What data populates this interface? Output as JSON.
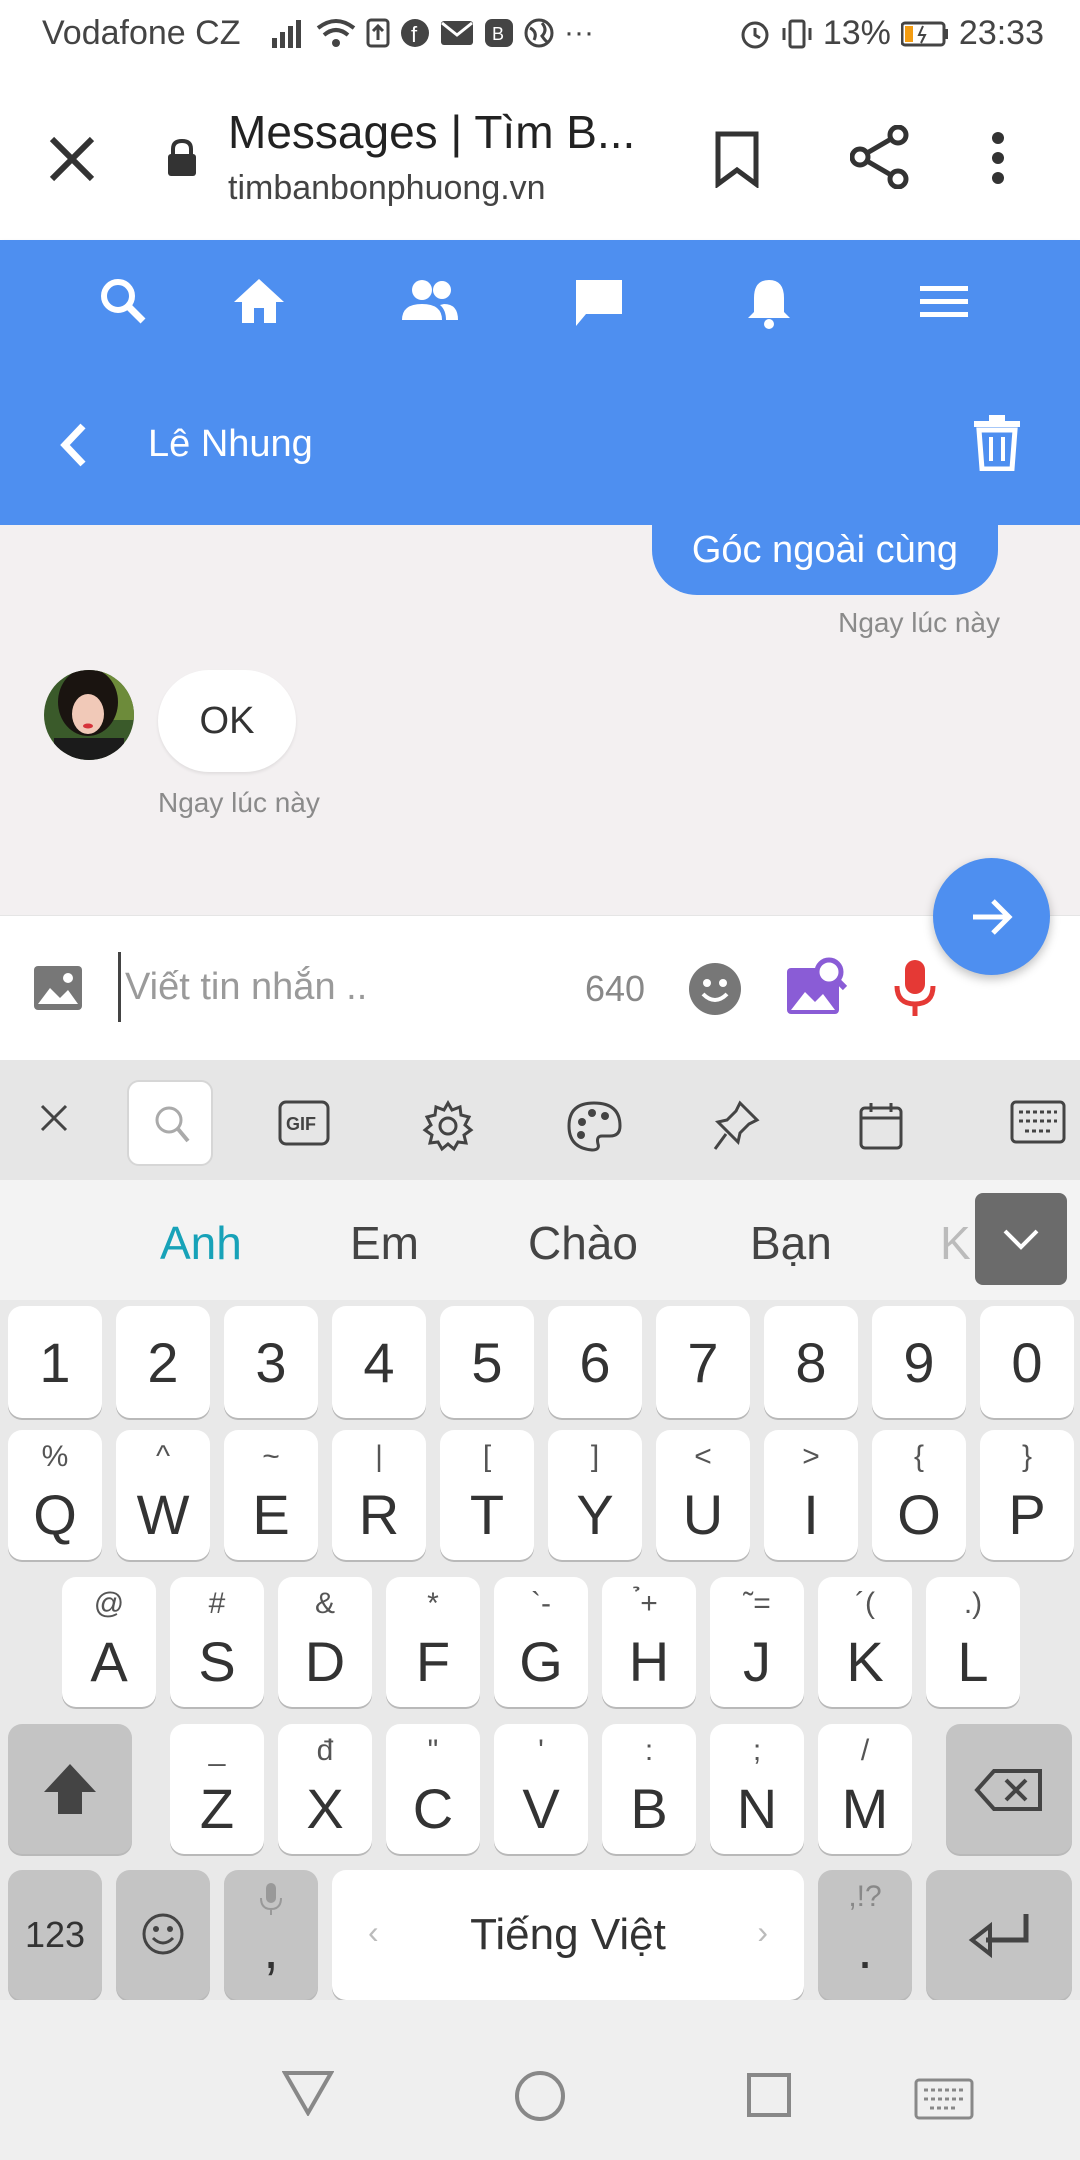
{
  "status_bar": {
    "carrier": "Vodafone CZ",
    "battery": "13%",
    "time": "23:33"
  },
  "browser": {
    "page_title": "Messages | Tìm B...",
    "url": "timbanbonphuong.vn"
  },
  "site_nav": {
    "icons": [
      "search-icon",
      "home-icon",
      "friends-icon",
      "messages-icon",
      "notifications-icon",
      "menu-icon"
    ]
  },
  "chat": {
    "contact_name": "Lê Nhung",
    "messages": [
      {
        "direction": "out",
        "text": "Góc ngoài cùng",
        "time": "Ngay lúc này"
      },
      {
        "direction": "in",
        "text": "OK",
        "time": "Ngay lúc này"
      }
    ]
  },
  "composer": {
    "placeholder": "Viết tin nhắn ..",
    "char_count": "640"
  },
  "keyboard": {
    "suggestions": [
      "Anh",
      "Em",
      "Chào",
      "Bạn",
      "K"
    ],
    "number_row": [
      "1",
      "2",
      "3",
      "4",
      "5",
      "6",
      "7",
      "8",
      "9",
      "0"
    ],
    "row_q": [
      {
        "alt": "%",
        "key": "Q"
      },
      {
        "alt": "^",
        "key": "W"
      },
      {
        "alt": "~",
        "key": "E"
      },
      {
        "alt": "|",
        "key": "R"
      },
      {
        "alt": "[",
        "key": "T"
      },
      {
        "alt": "]",
        "key": "Y"
      },
      {
        "alt": "<",
        "key": "U"
      },
      {
        "alt": ">",
        "key": "I"
      },
      {
        "alt": "{",
        "key": "O"
      },
      {
        "alt": "}",
        "key": "P"
      }
    ],
    "row_a": [
      {
        "alt": "@",
        "key": "A"
      },
      {
        "alt": "#",
        "key": "S"
      },
      {
        "alt": "&",
        "key": "D"
      },
      {
        "alt": "*",
        "key": "F"
      },
      {
        "alt": "`-",
        "key": "G"
      },
      {
        "alt": "̉+",
        "key": "H"
      },
      {
        "alt": "˜=",
        "key": "J"
      },
      {
        "alt": "´(",
        "key": "K"
      },
      {
        "alt": ".)",
        "key": "L"
      }
    ],
    "row_z": [
      {
        "alt": "_",
        "key": "Z"
      },
      {
        "alt": "đ",
        "key": "X"
      },
      {
        "alt": "\"",
        "key": "C"
      },
      {
        "alt": "'",
        "key": "V"
      },
      {
        "alt": ":",
        "key": "B"
      },
      {
        "alt": ";",
        "key": "N"
      },
      {
        "alt": "/",
        "key": "M"
      }
    ],
    "numbers_key": "123",
    "comma_key": ",",
    "space_label": "Tiếng Việt",
    "period_alt": ",!?",
    "period_key": "."
  },
  "colors": {
    "brand_blue": "#4e8ff0",
    "suggestion_active": "#17a2b8",
    "mic_red": "#e53935",
    "photo_search_purple": "#8a5cd6"
  }
}
